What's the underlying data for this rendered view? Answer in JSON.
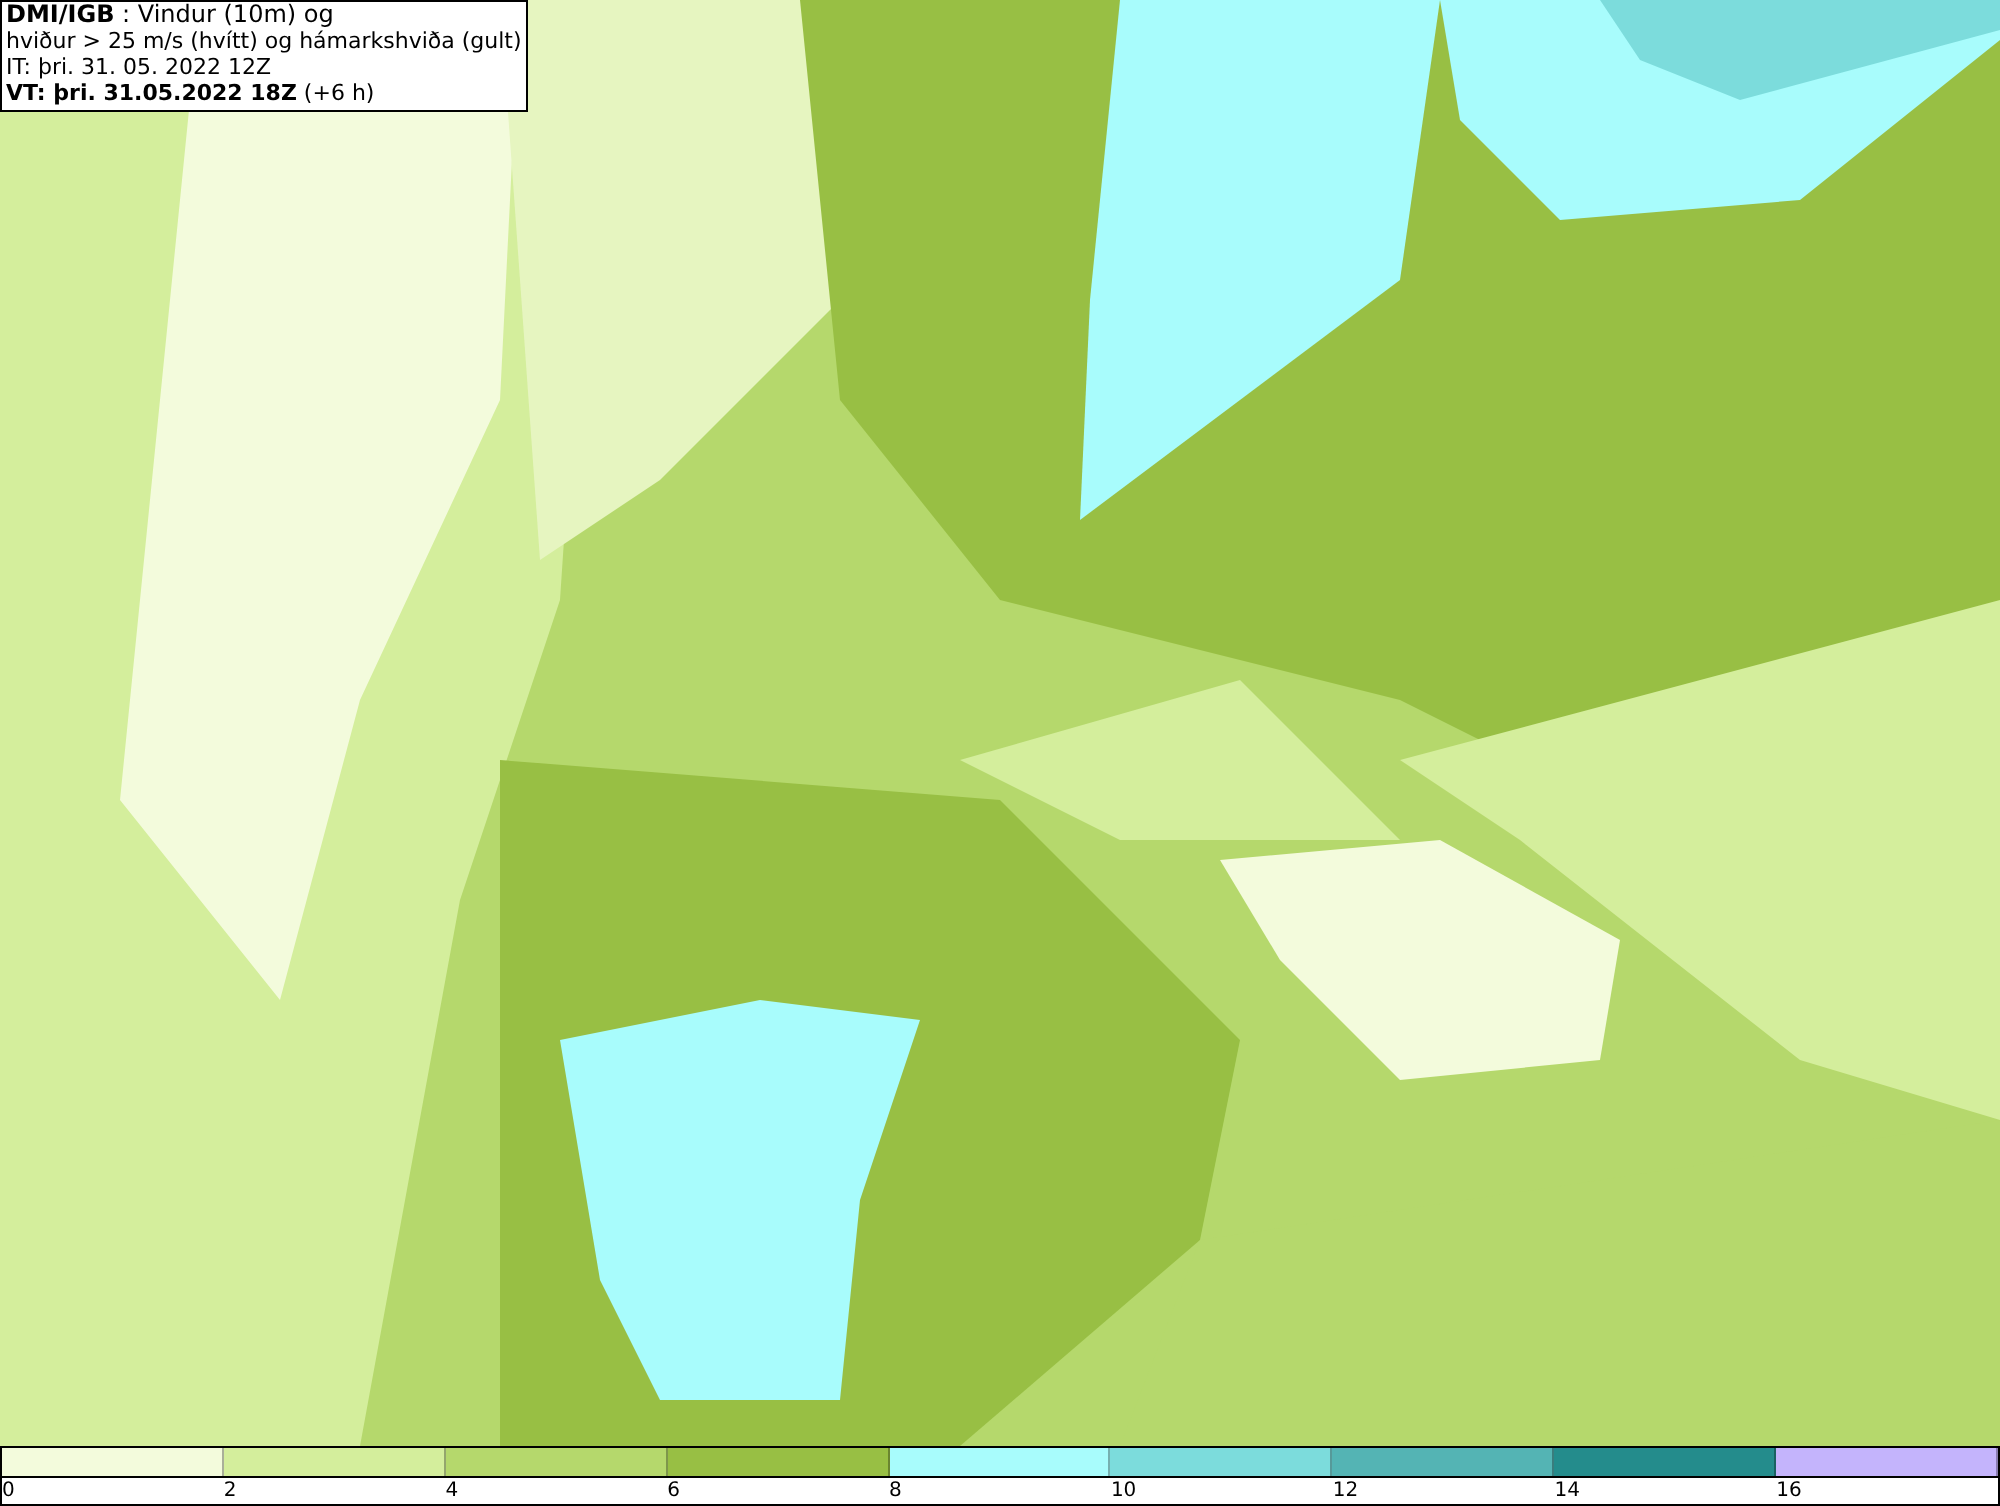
{
  "header": {
    "lines": [
      "**DMI/IGB** : Vindur (10m) og",
      "hviður > 25 m/s (hvítt) og hámarkshviða (gult)",
      "IT: þri. 31. 05. 2022 12Z",
      "**VT: þri. 31.05.2022 18Z** (+6 h)"
    ]
  },
  "legend": [
    {
      "label": "0",
      "color": "#f3fbdc"
    },
    {
      "label": "2",
      "color": "#d4ee9c"
    },
    {
      "label": "4",
      "color": "#b5d86c"
    },
    {
      "label": "6",
      "color": "#98bf44"
    },
    {
      "label": "8",
      "color": "#a8fcfc"
    },
    {
      "label": "10",
      "color": "#7cdcdc"
    },
    {
      "label": "12",
      "color": "#54b4b4"
    },
    {
      "label": "14",
      "color": "#248c8c"
    },
    {
      "label": "16",
      "color": "#c4b4fc"
    }
  ]
}
